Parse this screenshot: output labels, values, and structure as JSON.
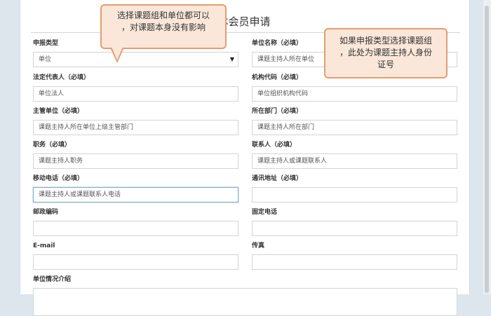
{
  "page": {
    "title": "本会员申请"
  },
  "form": {
    "rows": [
      [
        {
          "label": "申报类型",
          "value": "单位",
          "type": "select"
        },
        {
          "label": "单位名称（必填）",
          "value": "课题主持人所在单位"
        }
      ],
      [
        {
          "label": "法定代表人（必填）",
          "value": "单位法人"
        },
        {
          "label": "机构代码（必填）",
          "value": "单位组织机构代码"
        }
      ],
      [
        {
          "label": "主管单位（必填）",
          "value": "课题主持人所在单位上级主管部门"
        },
        {
          "label": "所在部门（必填）",
          "value": "课题主持人所在部门"
        }
      ],
      [
        {
          "label": "职务（必填）",
          "value": "课题主持人职务"
        },
        {
          "label": "联系人（必填）",
          "value": "课题主持人或课题联系人"
        }
      ],
      [
        {
          "label": "移动电话（必填）",
          "value": "课题主持人或课题联系人电话",
          "focused": true
        },
        {
          "label": "通讯地址（必填）",
          "value": ""
        }
      ],
      [
        {
          "label": "邮政编码",
          "value": ""
        },
        {
          "label": "固定电话",
          "value": ""
        }
      ],
      [
        {
          "label": "E-mail",
          "value": ""
        },
        {
          "label": "传真",
          "value": ""
        }
      ],
      [
        {
          "label": "单位情况介绍",
          "value": ""
        }
      ]
    ]
  },
  "callouts": {
    "left": {
      "line1": "选择课题组和单位都可以",
      "line2": "，对课题本身没有影响"
    },
    "right": {
      "line1": "如果申报类型选择课题组",
      "line2": "，此处为课题主持人身份",
      "line3": "证号"
    }
  },
  "colors": {
    "callout_fill": "#fae7d9",
    "callout_border": "#e89b70",
    "focus_border": "#7ea9d0"
  }
}
